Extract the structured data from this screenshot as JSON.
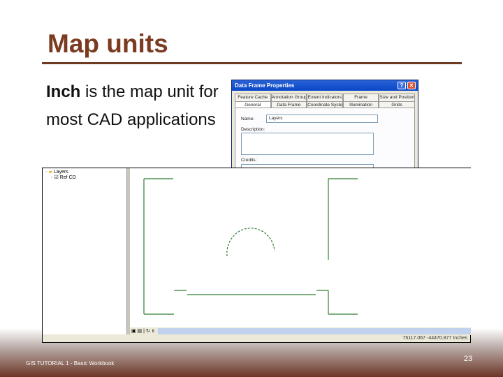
{
  "slide": {
    "title": "Map units",
    "body_bold": "Inch",
    "body_rest": " is the map unit for most CAD applications",
    "footer": "GIS TUTORIAL 1 - Basic Workbook",
    "page_number": "23"
  },
  "dialog": {
    "title": "Data Frame Properties",
    "help": "?",
    "close": "✕",
    "tabs_row1": [
      "Feature Cache",
      "Annotation Groups",
      "Extent Indicators",
      "Frame",
      "Size and Position"
    ],
    "tabs_row2": [
      "General",
      "Data Frame",
      "Coordinate System",
      "Illumination",
      "Grids"
    ],
    "name_label": "Name:",
    "name_value": "Layers",
    "description_label": "Description:",
    "credits_label": "Credits:"
  },
  "arcmap": {
    "toc": {
      "root": "Layers",
      "child": "Ref CD"
    },
    "status": "75117.067 -44470.877 Inches",
    "line_color": "#2e7d32"
  }
}
